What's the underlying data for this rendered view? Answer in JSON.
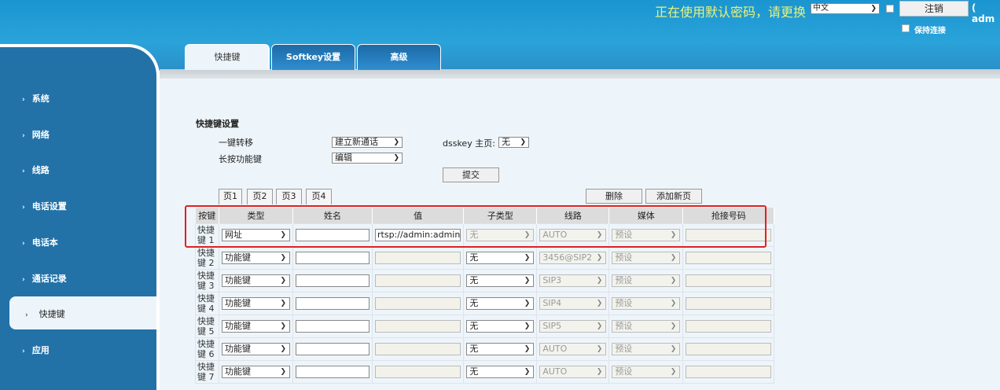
{
  "header": {
    "warning": "正在使用默认密码，请更换",
    "language": "中文",
    "logout": "注销",
    "user": "( adm",
    "keep_connected": "保持连接"
  },
  "sidebar": {
    "items": [
      {
        "label": "系统"
      },
      {
        "label": "网络"
      },
      {
        "label": "线路"
      },
      {
        "label": "电话设置"
      },
      {
        "label": "电话本"
      },
      {
        "label": "通话记录"
      },
      {
        "label": "快捷键",
        "active": true
      },
      {
        "label": "应用"
      }
    ]
  },
  "tabs": [
    {
      "label": "快捷键",
      "active": true
    },
    {
      "label": "Softkey设置"
    },
    {
      "label": "高级"
    }
  ],
  "settings": {
    "title": "快捷键设置",
    "transfer_label": "一键转移",
    "transfer_value": "建立新通话",
    "long_press_label": "长按功能键",
    "long_press_value": "编辑",
    "dsskey_label": "dsskey 主页:",
    "dsskey_value": "无",
    "submit": "提交"
  },
  "pages": [
    "页1",
    "页2",
    "页3",
    "页4"
  ],
  "actions": {
    "delete": "删除",
    "add_page": "添加新页"
  },
  "table": {
    "headers": [
      "按键",
      "类型",
      "姓名",
      "值",
      "子类型",
      "线路",
      "媒体",
      "抢接号码"
    ],
    "rows": [
      {
        "key": "快捷键 1",
        "type": "网址",
        "name": "",
        "value": "rtsp://admin:admin",
        "subtype": "无",
        "subtype_disabled": true,
        "line": "AUTO",
        "media": "预设",
        "pickup": ""
      },
      {
        "key": "快捷键 2",
        "type": "功能键",
        "name": "",
        "value": "",
        "subtype": "无",
        "subtype_disabled": false,
        "line": "3456@SIP2",
        "media": "预设",
        "pickup": ""
      },
      {
        "key": "快捷键 3",
        "type": "功能键",
        "name": "",
        "value": "",
        "subtype": "无",
        "subtype_disabled": false,
        "line": "SIP3",
        "media": "预设",
        "pickup": ""
      },
      {
        "key": "快捷键 4",
        "type": "功能键",
        "name": "",
        "value": "",
        "subtype": "无",
        "subtype_disabled": false,
        "line": "SIP4",
        "media": "预设",
        "pickup": ""
      },
      {
        "key": "快捷键 5",
        "type": "功能键",
        "name": "",
        "value": "",
        "subtype": "无",
        "subtype_disabled": false,
        "line": "SIP5",
        "media": "预设",
        "pickup": ""
      },
      {
        "key": "快捷键 6",
        "type": "功能键",
        "name": "",
        "value": "",
        "subtype": "无",
        "subtype_disabled": false,
        "line": "AUTO",
        "media": "预设",
        "pickup": ""
      },
      {
        "key": "快捷键 7",
        "type": "功能键",
        "name": "",
        "value": "",
        "subtype": "无",
        "subtype_disabled": false,
        "line": "AUTO",
        "media": "预设",
        "pickup": ""
      }
    ]
  },
  "colors": {
    "header_blue": "#1b95d0",
    "sidebar_blue": "#2272a8",
    "highlight": "#e02020",
    "warning_text": "#e8f27a"
  }
}
